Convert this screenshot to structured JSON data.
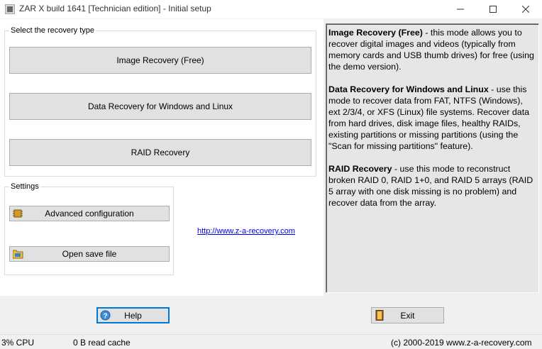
{
  "window": {
    "title": "ZAR X build 1641 [Technician edition] - Initial setup",
    "controls": [
      "minimize",
      "maximize",
      "close"
    ]
  },
  "recovery": {
    "legend": "Select the recovery type",
    "buttons": {
      "image": "Image Recovery (Free)",
      "data": "Data Recovery for Windows and Linux",
      "raid": "RAID Recovery"
    }
  },
  "settings": {
    "legend": "Settings",
    "advanced": "Advanced configuration",
    "open_save": "Open save file"
  },
  "link": "http://www.z-a-recovery.com",
  "info": {
    "image_title": "Image Recovery (Free)",
    "image_text": " - this mode allows you to recover digital images and videos (typically from memory cards and USB thumb drives) for free (using the demo version).",
    "data_title": "Data Recovery for Windows and Linux",
    "data_text": " - use this mode to recover data from FAT, NTFS (Windows), ext 2/3/4, or XFS (Linux) file systems. Recover data from hard drives, disk image files, healthy RAIDs, existing partitions or missing partitions (using the \"Scan for missing partitions\" feature).",
    "raid_title": "RAID Recovery",
    "raid_text": " - use this mode to reconstruct broken RAID 0, RAID 1+0, and RAID 5 arrays (RAID 5 array with one disk missing is no problem) and recover data from the array."
  },
  "footer": {
    "help": "Help",
    "exit": "Exit"
  },
  "status": {
    "cpu": "3% CPU",
    "cache": "0 B read cache",
    "copyright": "(c) 2000-2019 www.z-a-recovery.com"
  },
  "icons": {
    "app": "app-icon",
    "help": "help-icon",
    "exit": "exit-door-icon",
    "advanced": "chip-icon",
    "open_save": "folder-icon"
  }
}
